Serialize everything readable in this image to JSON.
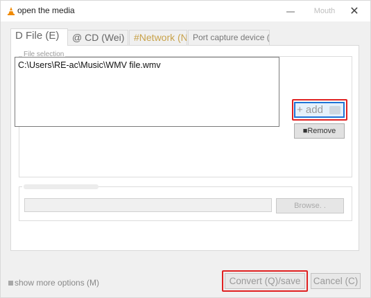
{
  "window": {
    "title": "open the media",
    "minimize_glyph": "—",
    "maximize_label": "Mouth",
    "close_glyph": "✕",
    "app_icon": "vlc-cone-icon",
    "accent_color": "#e07b00"
  },
  "tabs": [
    {
      "label": "D File (E)",
      "active": true
    },
    {
      "label": "@ CD (Wei)",
      "active": false
    },
    {
      "label": "#Network (N",
      "active": false
    },
    {
      "label": "Port capture device ()",
      "active": false
    }
  ],
  "file_selection": {
    "legend": "File selection",
    "files": [
      "C:\\Users\\RE-ac\\Music\\WMV file.wmv"
    ],
    "add_label": "+ add",
    "remove_label": "■Remove"
  },
  "subtitle_group": {
    "browse_label": "Browse. .",
    "path_value": ""
  },
  "footer": {
    "show_more_label": "show more options (M)",
    "convert_label": "Convert (Q)/save",
    "cancel_label": "Cancel (C)"
  },
  "highlight_color": "#e02020"
}
